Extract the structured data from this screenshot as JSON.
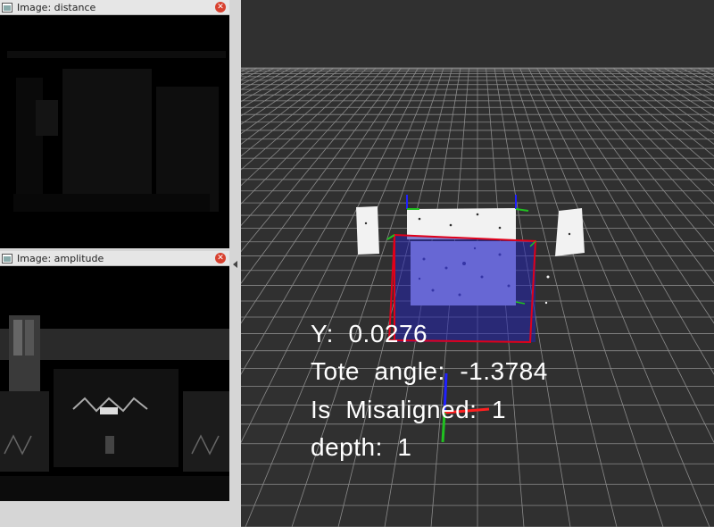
{
  "panels": {
    "distance": {
      "title": "Image: distance",
      "close_icon": "close-icon"
    },
    "amplitude": {
      "title": "Image: amplitude",
      "close_icon": "close-icon"
    }
  },
  "viewport": {
    "overlay": {
      "y_line": "Y:  0.0276",
      "angle_line": "Tote  angle:  -1.3784",
      "misaligned_line": "Is  Misaligned:  1",
      "depth_line": "depth:  1"
    }
  },
  "colors": {
    "grid": "#8a8a8a",
    "tote_fill": "#b8b8ff",
    "bbox": "#e0001a",
    "axis_x": "#ff2020",
    "axis_y": "#20c020",
    "axis_z": "#2020ff"
  }
}
